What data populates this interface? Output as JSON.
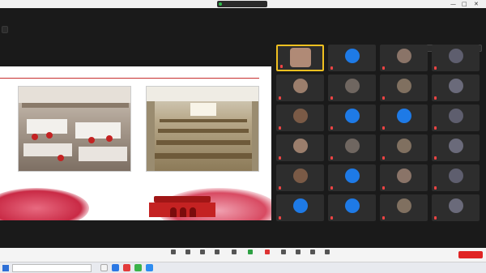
{
  "window": {
    "title": "",
    "controls": [
      "—",
      "□",
      "✕"
    ]
  },
  "share_tag": "",
  "view_button": "",
  "slide": {
    "heading": "",
    "caption_left": "",
    "caption_right": ""
  },
  "participants": [
    {
      "name": "",
      "avatar_text": "",
      "camera": true
    },
    {
      "name": "",
      "avatar_text": "",
      "avatar_color": "#1e7ae6"
    },
    {
      "name": "",
      "avatar_text": ""
    },
    {
      "name": "",
      "avatar_text": ""
    },
    {
      "name": "",
      "avatar_text": ""
    },
    {
      "name": "",
      "avatar_text": ""
    },
    {
      "name": "",
      "avatar_text": ""
    },
    {
      "name": "",
      "avatar_text": ""
    },
    {
      "name": "",
      "avatar_text": ""
    },
    {
      "name": "",
      "avatar_text": "",
      "avatar_color": "#1e7ae6"
    },
    {
      "name": "",
      "avatar_text": "",
      "avatar_color": "#1e7ae6"
    },
    {
      "name": "",
      "avatar_text": ""
    },
    {
      "name": "",
      "avatar_text": ""
    },
    {
      "name": "",
      "avatar_text": ""
    },
    {
      "name": "",
      "avatar_text": ""
    },
    {
      "name": "",
      "avatar_text": ""
    },
    {
      "name": "",
      "avatar_text": ""
    },
    {
      "name": "",
      "avatar_text": "",
      "avatar_color": "#1e7ae6"
    },
    {
      "name": "",
      "avatar_text": ""
    },
    {
      "name": "",
      "avatar_text": ""
    },
    {
      "name": "",
      "avatar_text": "",
      "avatar_color": "#1e7ae6"
    },
    {
      "name": "",
      "avatar_text": "",
      "avatar_color": "#1e7ae6"
    },
    {
      "name": "",
      "avatar_text": ""
    },
    {
      "name": "",
      "avatar_text": ""
    }
  ],
  "toolbar": {
    "items": [
      {
        "label": "",
        "icon": "mic-icon"
      },
      {
        "label": "",
        "icon": "video-icon"
      },
      {
        "label": "",
        "icon": "security-icon"
      },
      {
        "label": "",
        "icon": "participants-icon"
      },
      {
        "label": "",
        "icon": "chat-icon"
      },
      {
        "label": "",
        "icon": "share-screen-icon"
      },
      {
        "label": "",
        "icon": "record-icon"
      },
      {
        "label": "",
        "icon": "reactions-icon"
      },
      {
        "label": "",
        "icon": "apps-icon"
      },
      {
        "label": "",
        "icon": "whiteboard-icon"
      },
      {
        "label": "",
        "icon": "more-icon"
      }
    ],
    "end_label": ""
  },
  "taskbar": {
    "search_placeholder": "",
    "time": "",
    "date": ""
  }
}
